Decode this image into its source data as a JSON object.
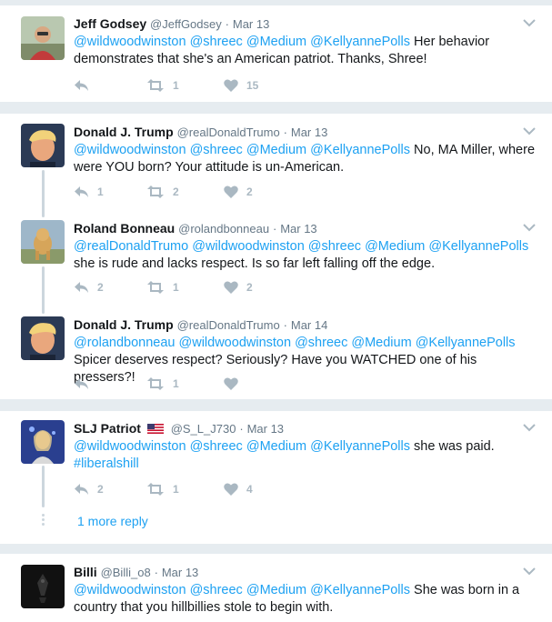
{
  "tweets": [
    {
      "name": "Jeff Godsey",
      "handle": "@JeffGodsey",
      "time": "Mar 13",
      "mentions": [
        "@wildwoodwinston",
        "@shreec",
        "@Medium",
        "@KellyannePolls"
      ],
      "body": "Her behavior demonstrates that she's an American patriot. Thanks, Shree!",
      "replies": "",
      "retweets": "1",
      "likes": "15"
    },
    {
      "name": "Donald J. Trump",
      "handle": "@realDonaldTrumo",
      "time": "Mar 13",
      "mentions": [
        "@wildwoodwinston",
        "@shreec",
        "@Medium",
        "@KellyannePolls"
      ],
      "body": "No, MA Miller, where were YOU born? Your attitude is un-American.",
      "replies": "1",
      "retweets": "2",
      "likes": "2"
    },
    {
      "name": "Roland Bonneau",
      "handle": "@rolandbonneau",
      "time": "Mar 13",
      "mentions": [
        "@realDonaldTrumo",
        "@wildwoodwinston",
        "@shreec",
        "@Medium",
        "@KellyannePolls"
      ],
      "body": "she is rude and lacks respect. Is so far left falling off the edge.",
      "replies": "2",
      "retweets": "1",
      "likes": "2"
    },
    {
      "name": "Donald J. Trump",
      "handle": "@realDonaldTrumo",
      "time": "Mar 14",
      "mentions": [
        "@rolandbonneau",
        "@wildwoodwinston",
        "@shreec",
        "@Medium",
        "@KellyannePolls"
      ],
      "body": "Spicer deserves respect? Seriously? Have you WATCHED one of his pressers?!",
      "replies": "",
      "retweets": "1",
      "likes": ""
    },
    {
      "name": "SLJ Patriot",
      "handle": "@S_L_J730",
      "time": "Mar 13",
      "mentions": [
        "@wildwoodwinston",
        "@shreec",
        "@Medium",
        "@KellyannePolls"
      ],
      "body": "she was paid.",
      "hashtag": "#liberalshill",
      "replies": "2",
      "retweets": "1",
      "likes": "4"
    },
    {
      "name": "Billi",
      "handle": "@Billi_o8",
      "time": "Mar 13",
      "mentions": [
        "@wildwoodwinston",
        "@shreec",
        "@Medium",
        "@KellyannePolls"
      ],
      "body": "She was born in a country that you hillbillies stole to begin with."
    }
  ],
  "more_reply": "1 more reply",
  "separator": "·",
  "colors": {
    "link": "#1da1f2",
    "muted": "#657786",
    "icon": "#aab8c2",
    "background": "#e6ecf0"
  },
  "icons": [
    "reply-icon",
    "retweet-icon",
    "heart-icon",
    "chevron-down-icon",
    "us-flag-icon"
  ]
}
